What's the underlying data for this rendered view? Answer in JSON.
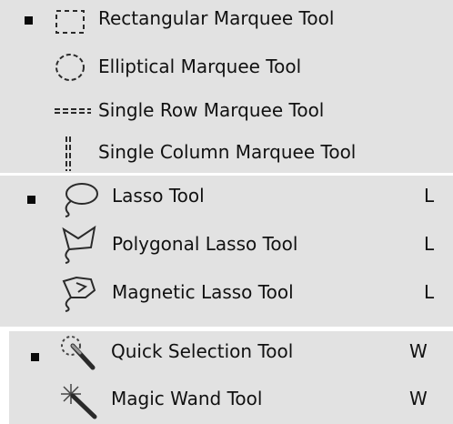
{
  "groups": [
    {
      "items": [
        {
          "label": "Rectangular Marquee Tool",
          "shortcut": "",
          "icon": "rectangular-marquee-icon",
          "selected": true
        },
        {
          "label": "Elliptical Marquee Tool",
          "shortcut": "",
          "icon": "elliptical-marquee-icon",
          "selected": false
        },
        {
          "label": "Single Row Marquee Tool",
          "shortcut": "",
          "icon": "single-row-marquee-icon",
          "selected": false
        },
        {
          "label": "Single Column Marquee Tool",
          "shortcut": "",
          "icon": "single-column-marquee-icon",
          "selected": false
        }
      ]
    },
    {
      "items": [
        {
          "label": "Lasso Tool",
          "shortcut": "L",
          "icon": "lasso-icon",
          "selected": true
        },
        {
          "label": "Polygonal Lasso Tool",
          "shortcut": "L",
          "icon": "polygonal-lasso-icon",
          "selected": false
        },
        {
          "label": "Magnetic Lasso Tool",
          "shortcut": "L",
          "icon": "magnetic-lasso-icon",
          "selected": false
        }
      ]
    },
    {
      "items": [
        {
          "label": "Quick Selection Tool",
          "shortcut": "W",
          "icon": "quick-selection-icon",
          "selected": true
        },
        {
          "label": "Magic Wand Tool",
          "shortcut": "W",
          "icon": "magic-wand-icon",
          "selected": false
        }
      ]
    }
  ],
  "colors": {
    "panel": "#e2e2e2",
    "text": "#111111",
    "divider": "#ffffff"
  }
}
